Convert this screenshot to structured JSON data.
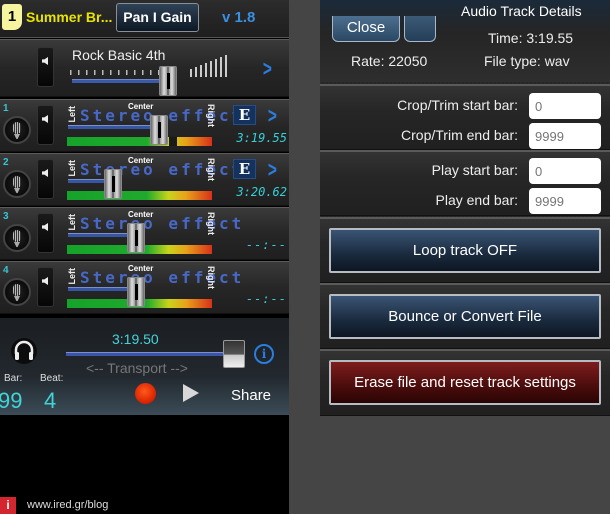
{
  "header": {
    "track_number": "1",
    "song_title": "Summer Br...",
    "pan_gain_label": "Pan I Gain",
    "version": "v 1.8"
  },
  "rhythm": {
    "name": "Rock Basic 4th",
    "volume_level_percent": 68
  },
  "tracks": [
    {
      "number": "1",
      "left_label": "Left",
      "center_label": "Center",
      "right_label": "Right",
      "stereo_text": "Stereo effect",
      "edit_label": "E",
      "time": "3:19.55",
      "pan_percent": 68,
      "has_edit": true
    },
    {
      "number": "2",
      "left_label": "Left",
      "center_label": "Center",
      "right_label": "Right",
      "stereo_text": "Stereo effect",
      "edit_label": "E",
      "time": "3:20.62",
      "pan_percent": 32,
      "has_edit": true
    },
    {
      "number": "3",
      "left_label": "Left",
      "center_label": "Center",
      "right_label": "Right",
      "stereo_text": "Stereo effect",
      "edit_label": "",
      "time": "--:--",
      "pan_percent": 50,
      "has_edit": false
    },
    {
      "number": "4",
      "left_label": "Left",
      "center_label": "Center",
      "right_label": "Right",
      "stereo_text": "Stereo effect",
      "edit_label": "",
      "time": "--:--",
      "pan_percent": 50,
      "has_edit": false
    }
  ],
  "transport": {
    "time": "3:19.50",
    "label": "<--  Transport  -->",
    "position_percent": 100,
    "bar_label": "Bar:",
    "bar_value": "99",
    "beat_label": "Beat:",
    "beat_value": "4",
    "share_label": "Share",
    "info_label": "i"
  },
  "watermark": {
    "logo": "i",
    "text": "www.ired.gr/blog"
  },
  "details": {
    "title": "Audio Track Details",
    "close_label": "Close",
    "time": "Time:  3:19.55",
    "rate": "Rate: 22050",
    "file_type": "File type: wav",
    "fields": {
      "crop_start": {
        "label": "Crop/Trim start bar:",
        "placeholder": "0"
      },
      "crop_end": {
        "label": "Crop/Trim end bar:",
        "placeholder": "9999"
      },
      "play_start": {
        "label": "Play start bar:",
        "placeholder": "0"
      },
      "play_end": {
        "label": "Play end bar:",
        "placeholder": "9999"
      }
    },
    "loop_label": "Loop track OFF",
    "bounce_label": "Bounce or Convert File",
    "erase_label": "Erase file and reset track settings"
  },
  "colors": {
    "accent_blue": "#2b7de0",
    "time_cyan": "#36d0d8",
    "title_yellow": "#e8e400",
    "erase_red": "#7e1d1d",
    "record_red": "#d81f00"
  }
}
